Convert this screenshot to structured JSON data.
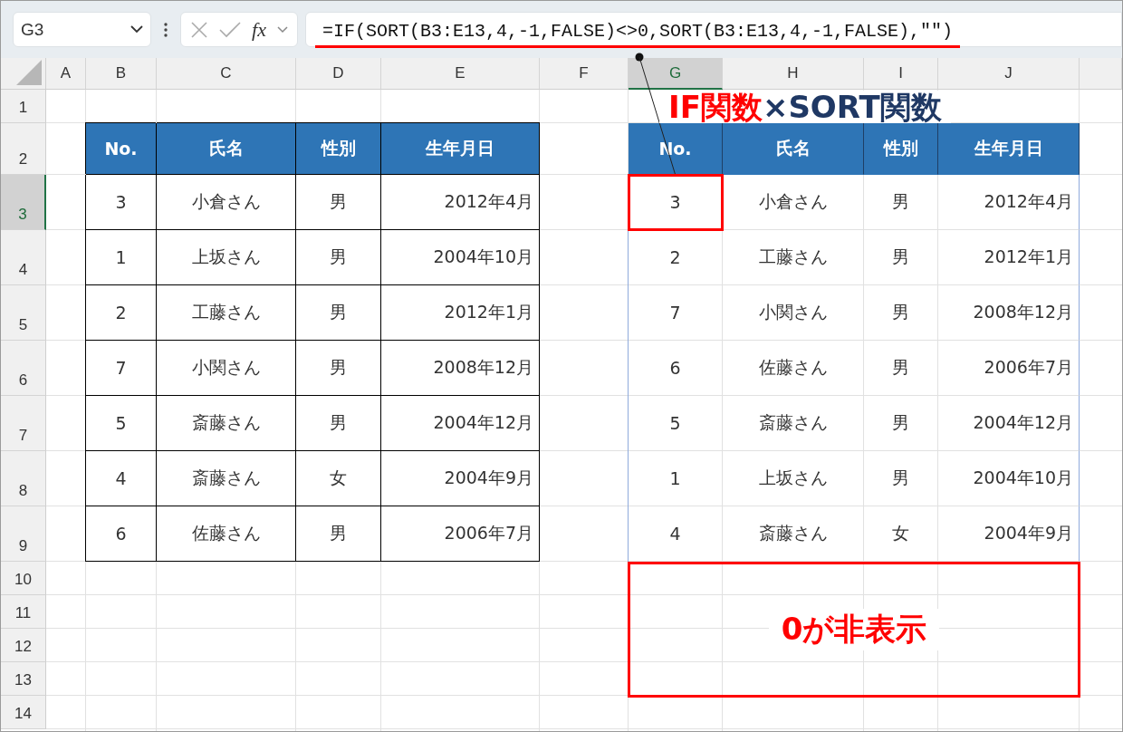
{
  "name_box": "G3",
  "function_button": "fx",
  "formula": "=IF(SORT(B3:E13,4,-1,FALSE)<>0,SORT(B3:E13,4,-1,FALSE),\"\")",
  "columns": [
    {
      "label": "A",
      "selected": false
    },
    {
      "label": "B",
      "selected": false
    },
    {
      "label": "C",
      "selected": false
    },
    {
      "label": "D",
      "selected": false
    },
    {
      "label": "E",
      "selected": false
    },
    {
      "label": "F",
      "selected": false
    },
    {
      "label": "G",
      "selected": true
    },
    {
      "label": "H",
      "selected": false
    },
    {
      "label": "I",
      "selected": false
    },
    {
      "label": "J",
      "selected": false
    }
  ],
  "rows": [
    {
      "label": "1",
      "selected": false
    },
    {
      "label": "2",
      "selected": false
    },
    {
      "label": "3",
      "selected": true
    },
    {
      "label": "4",
      "selected": false
    },
    {
      "label": "5",
      "selected": false
    },
    {
      "label": "6",
      "selected": false
    },
    {
      "label": "7",
      "selected": false
    },
    {
      "label": "8",
      "selected": false
    },
    {
      "label": "9",
      "selected": false
    },
    {
      "label": "10",
      "selected": false
    },
    {
      "label": "11",
      "selected": false
    },
    {
      "label": "12",
      "selected": false
    },
    {
      "label": "13",
      "selected": false
    },
    {
      "label": "14",
      "selected": false
    }
  ],
  "source_table": {
    "headers": [
      "No.",
      "氏名",
      "性別",
      "生年月日"
    ],
    "rows": [
      [
        "3",
        "小倉さん",
        "男",
        "2012年4月"
      ],
      [
        "1",
        "上坂さん",
        "男",
        "2004年10月"
      ],
      [
        "2",
        "工藤さん",
        "男",
        "2012年1月"
      ],
      [
        "7",
        "小関さん",
        "男",
        "2008年12月"
      ],
      [
        "5",
        "斎藤さん",
        "男",
        "2004年12月"
      ],
      [
        "4",
        "斎藤さん",
        "女",
        "2004年9月"
      ],
      [
        "6",
        "佐藤さん",
        "男",
        "2006年7月"
      ]
    ]
  },
  "result_table": {
    "headers": [
      "No.",
      "氏名",
      "性別",
      "生年月日"
    ],
    "rows": [
      [
        "3",
        "小倉さん",
        "男",
        "2012年4月"
      ],
      [
        "2",
        "工藤さん",
        "男",
        "2012年1月"
      ],
      [
        "7",
        "小関さん",
        "男",
        "2008年12月"
      ],
      [
        "6",
        "佐藤さん",
        "男",
        "2006年7月"
      ],
      [
        "5",
        "斎藤さん",
        "男",
        "2004年12月"
      ],
      [
        "1",
        "上坂さん",
        "男",
        "2004年10月"
      ],
      [
        "4",
        "斎藤さん",
        "女",
        "2004年9月"
      ]
    ]
  },
  "title": [
    "IF関数",
    "×SORT関数"
  ],
  "note": "0が非表示"
}
